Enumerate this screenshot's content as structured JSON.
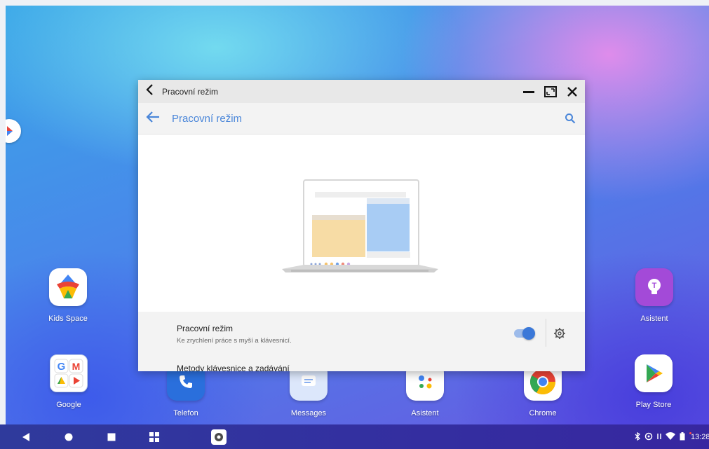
{
  "window": {
    "caption_title": "Pracovní režim",
    "appbar_title": "Pracovní režim"
  },
  "settings": {
    "row1_title": "Pracovní režim",
    "row1_subtitle": "Ke zrychlení práce s myší a klávesnicí.",
    "row1_toggle_on": true,
    "row2_title": "Metody klávesnice a zadávání"
  },
  "apps": {
    "kids_space": "Kids Space",
    "google": "Google",
    "telefon": "Telefon",
    "messages": "Messages",
    "asistent_dock": "Asistent",
    "chrome": "Chrome",
    "play_store": "Play Store",
    "asistent_right": "Asistent"
  },
  "status": {
    "time": "13:28"
  },
  "icons": [
    "back-arrow-icon",
    "minimize-icon",
    "maximize-icon",
    "close-icon",
    "search-icon",
    "settings-gear-icon",
    "nav-back-icon",
    "nav-home-icon",
    "nav-recents-icon",
    "app-drawer-icon",
    "settings-app-icon",
    "bluetooth-icon",
    "wifi-icon",
    "battery-icon"
  ],
  "colors": {
    "accent": "#4a86d9",
    "toggle": "#3b78d8"
  }
}
